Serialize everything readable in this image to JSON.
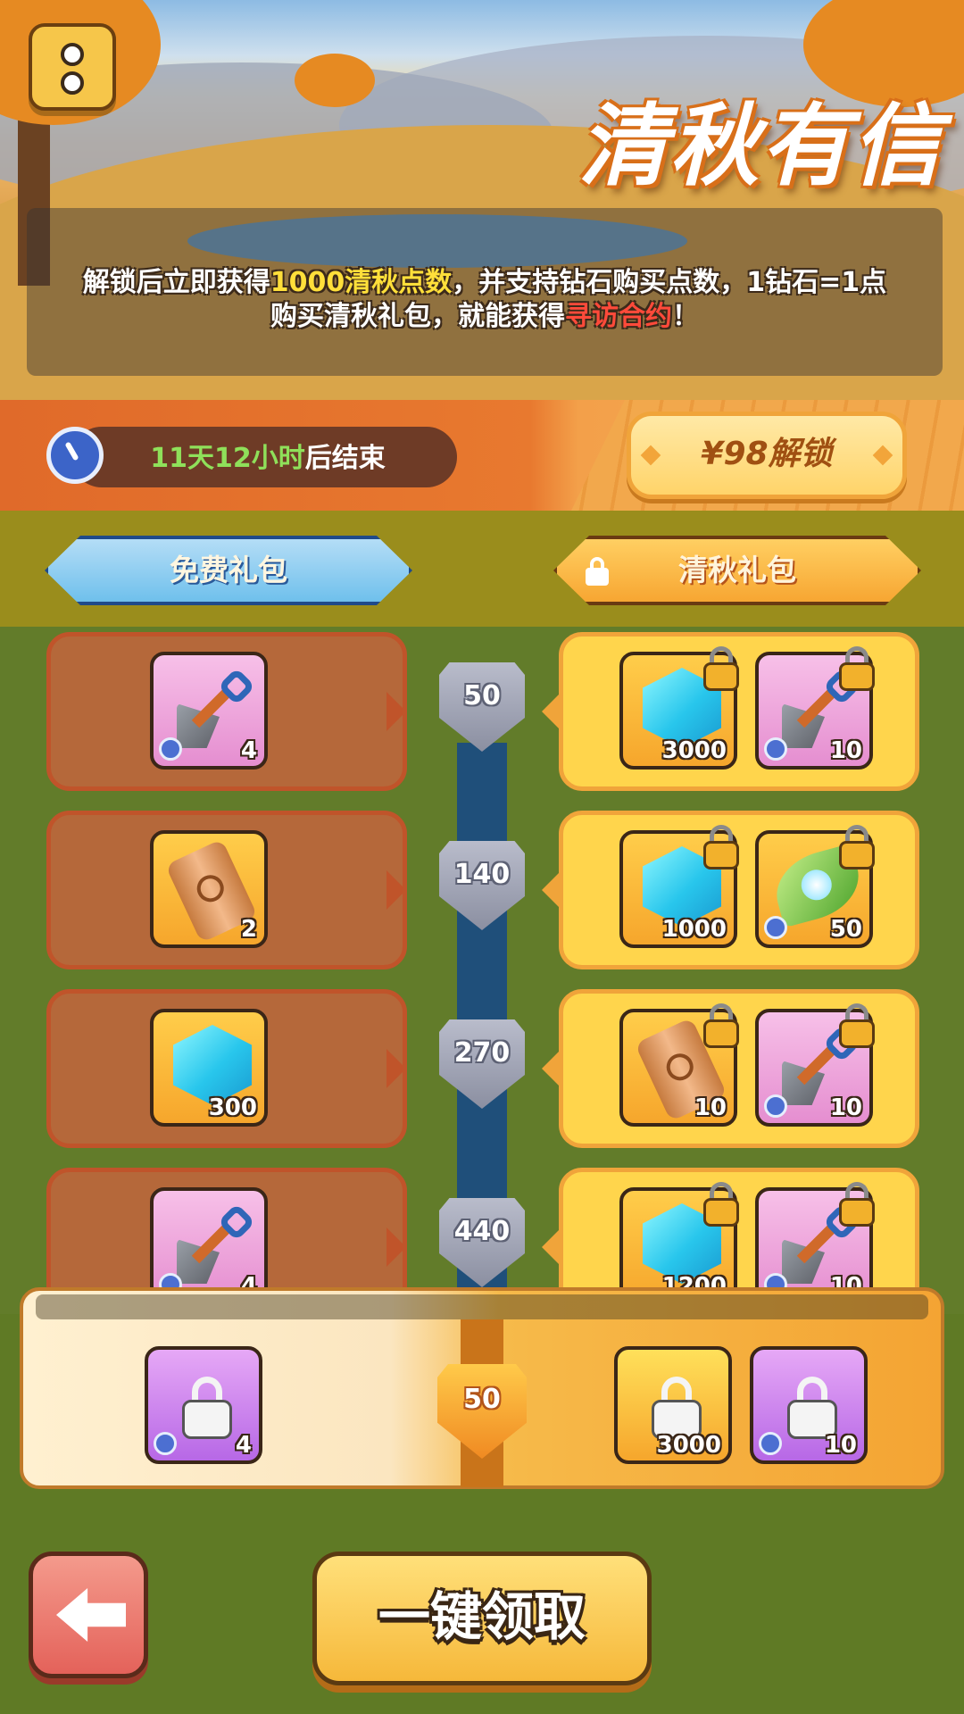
{
  "banner": {
    "title": "清秋有信",
    "info_line1_pre": "解锁后立即获得",
    "info_line1_highlight": "1000清秋点数",
    "info_line1_post": "，并支持钻石购买点数，1钻石=1点",
    "info_line2_pre": "购买清秋礼包，就能获得",
    "info_line2_highlight": "寻访合约",
    "info_line2_post": "！"
  },
  "timer": {
    "countdown": "11天12小时",
    "suffix": "后结束"
  },
  "unlock_button": {
    "label": "¥98解锁"
  },
  "tabs": {
    "free": "免费礼包",
    "paid": "清秋礼包"
  },
  "tiers": [
    {
      "level": "50",
      "free": [
        {
          "icon": "shovel-icon",
          "qty": "4"
        }
      ],
      "paid": [
        {
          "icon": "diamond-icon",
          "qty": "3000",
          "locked": true
        },
        {
          "icon": "shovel-icon",
          "qty": "10",
          "locked": true
        }
      ]
    },
    {
      "level": "140",
      "free": [
        {
          "icon": "scroll-icon",
          "qty": "2"
        }
      ],
      "paid": [
        {
          "icon": "diamond-icon",
          "qty": "1000",
          "locked": true
        },
        {
          "icon": "leaf-icon",
          "qty": "50",
          "locked": true
        }
      ]
    },
    {
      "level": "270",
      "free": [
        {
          "icon": "diamond-icon",
          "qty": "300"
        }
      ],
      "paid": [
        {
          "icon": "scroll-icon",
          "qty": "10",
          "locked": true
        },
        {
          "icon": "shovel-icon",
          "qty": "10",
          "locked": true
        }
      ]
    },
    {
      "level": "440",
      "free": [
        {
          "icon": "shovel-icon",
          "qty": "4"
        }
      ],
      "paid": [
        {
          "icon": "diamond-icon",
          "qty": "1200",
          "locked": true
        },
        {
          "icon": "shovel-icon",
          "qty": "10",
          "locked": true
        }
      ]
    }
  ],
  "progress": {
    "level": "50",
    "free_qty": "4",
    "paid_qty_1": "3000",
    "paid_qty_2": "10"
  },
  "buttons": {
    "claim_all": "一键领取"
  }
}
